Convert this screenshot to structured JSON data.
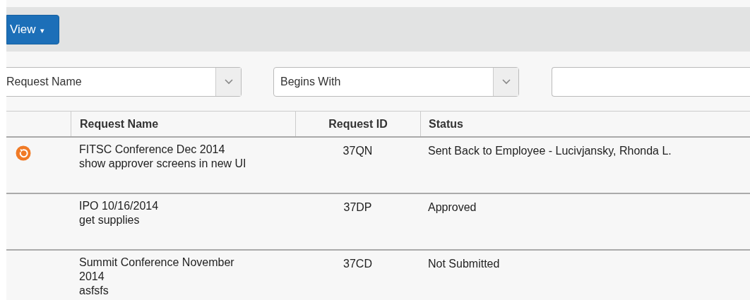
{
  "toolbar": {
    "view_button": {
      "label": "View",
      "caret": "▾"
    }
  },
  "filters": {
    "field_select": {
      "value": "Request Name"
    },
    "operator_select": {
      "value": "Begins With"
    }
  },
  "table": {
    "columns": [
      "Request Name",
      "Request ID",
      "Status"
    ],
    "rows": [
      {
        "sent_back": true,
        "name": "FITSC Conference Dec 2014",
        "description": "show approver screens in new UI",
        "id": "37QN",
        "status": "Sent Back to Employee - Lucivjansky, Rhonda L."
      },
      {
        "sent_back": false,
        "name": "IPO 10/16/2014",
        "description": "get supplies",
        "id": "37DP",
        "status": "Approved"
      },
      {
        "sent_back": false,
        "name": "Summit Conference November 2014",
        "description": "asfsfs",
        "id": "37CD",
        "status": "Not Submitted"
      }
    ]
  }
}
